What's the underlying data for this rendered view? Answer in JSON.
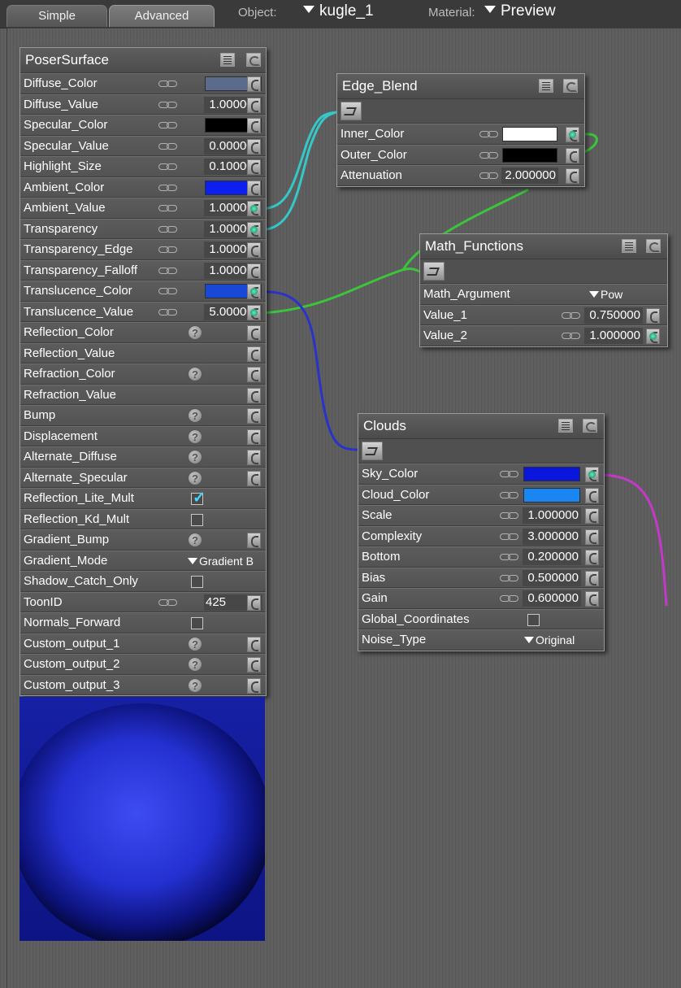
{
  "header": {
    "tabs": [
      {
        "label": "Simple",
        "active": false
      },
      {
        "label": "Advanced",
        "active": true
      }
    ],
    "object_label": "Object:",
    "object_value": "kugle_1",
    "material_label": "Material:",
    "material_value": "Preview"
  },
  "poser_surface": {
    "title": "PoserSurface",
    "rows": [
      {
        "label": "Diffuse_Color",
        "kind": "color",
        "color": "#5a6b8c"
      },
      {
        "label": "Diffuse_Value",
        "kind": "value",
        "value": "1.000000"
      },
      {
        "label": "Specular_Color",
        "kind": "color",
        "color": "#000000"
      },
      {
        "label": "Specular_Value",
        "kind": "value",
        "value": "0.000000"
      },
      {
        "label": "Highlight_Size",
        "kind": "value",
        "value": "0.100000"
      },
      {
        "label": "Ambient_Color",
        "kind": "color",
        "color": "#0a1ff0"
      },
      {
        "label": "Ambient_Value",
        "kind": "value",
        "value": "1.000000",
        "connected": true
      },
      {
        "label": "Transparency",
        "kind": "value",
        "value": "1.000000",
        "connected": true
      },
      {
        "label": "Transparency_Edge",
        "kind": "value",
        "value": "1.000000"
      },
      {
        "label": "Transparency_Falloff",
        "kind": "value",
        "value": "1.000000"
      },
      {
        "label": "Translucence_Color",
        "kind": "color",
        "color": "#1a48d6",
        "connected": true
      },
      {
        "label": "Translucence_Value",
        "kind": "value",
        "value": "5.000000",
        "connected": true
      },
      {
        "label": "Reflection_Color",
        "kind": "question"
      },
      {
        "label": "Reflection_Value",
        "kind": "empty"
      },
      {
        "label": "Refraction_Color",
        "kind": "question"
      },
      {
        "label": "Refraction_Value",
        "kind": "empty"
      },
      {
        "label": "Bump",
        "kind": "question"
      },
      {
        "label": "Displacement",
        "kind": "question"
      },
      {
        "label": "Alternate_Diffuse",
        "kind": "question"
      },
      {
        "label": "Alternate_Specular",
        "kind": "question"
      },
      {
        "label": "Reflection_Lite_Mult",
        "kind": "checkbox",
        "checked": true
      },
      {
        "label": "Reflection_Kd_Mult",
        "kind": "checkbox",
        "checked": false
      },
      {
        "label": "Gradient_Bump",
        "kind": "question"
      },
      {
        "label": "Gradient_Mode",
        "kind": "dropdown",
        "value": "Gradient B"
      },
      {
        "label": "Shadow_Catch_Only",
        "kind": "checkbox",
        "checked": false
      },
      {
        "label": "ToonID",
        "kind": "value",
        "value": "425",
        "align": "left"
      },
      {
        "label": "Normals_Forward",
        "kind": "checkbox",
        "checked": false
      },
      {
        "label": "Custom_output_1",
        "kind": "question"
      },
      {
        "label": "Custom_output_2",
        "kind": "question"
      },
      {
        "label": "Custom_output_3",
        "kind": "question"
      }
    ]
  },
  "edge_blend": {
    "title": "Edge_Blend",
    "rows": [
      {
        "label": "Inner_Color",
        "kind": "color",
        "color": "#ffffff",
        "connected": true
      },
      {
        "label": "Outer_Color",
        "kind": "color",
        "color": "#000000"
      },
      {
        "label": "Attenuation",
        "kind": "value",
        "value": "2.000000"
      }
    ]
  },
  "math_functions": {
    "title": "Math_Functions",
    "rows": [
      {
        "label": "Math_Argument",
        "kind": "dropdown",
        "value": "Pow"
      },
      {
        "label": "Value_1",
        "kind": "value",
        "value": "0.750000"
      },
      {
        "label": "Value_2",
        "kind": "value",
        "value": "1.000000",
        "connected": true
      }
    ]
  },
  "clouds": {
    "title": "Clouds",
    "rows": [
      {
        "label": "Sky_Color",
        "kind": "color",
        "color": "#0a16dc",
        "connected": true
      },
      {
        "label": "Cloud_Color",
        "kind": "color",
        "color": "#1a86f2"
      },
      {
        "label": "Scale",
        "kind": "value",
        "value": "1.000000"
      },
      {
        "label": "Complexity",
        "kind": "value",
        "value": "3.000000"
      },
      {
        "label": "Bottom",
        "kind": "value",
        "value": "0.200000"
      },
      {
        "label": "Bias",
        "kind": "value",
        "value": "0.500000"
      },
      {
        "label": "Gain",
        "kind": "value",
        "value": "0.600000"
      },
      {
        "label": "Global_Coordinates",
        "kind": "checkbox",
        "checked": false
      },
      {
        "label": "Noise_Type",
        "kind": "dropdown",
        "value": "Original"
      }
    ]
  },
  "wire_colors": {
    "edge_blend": "#35c8c8",
    "math_functions": "#3cc43c",
    "clouds": "#2a33c8",
    "clouds_out": "#c23ac8"
  }
}
